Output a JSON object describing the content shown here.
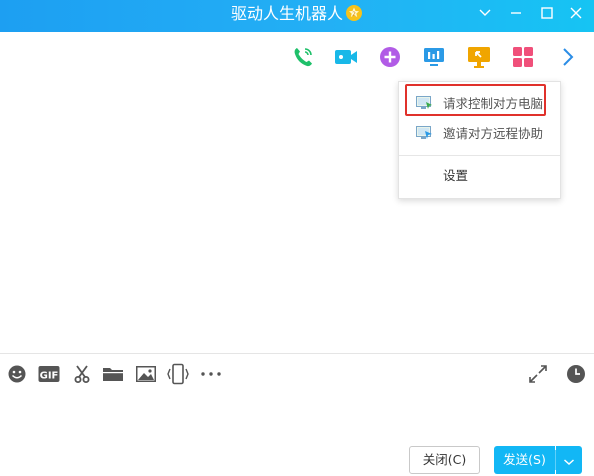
{
  "window": {
    "title": "驱动人生机器人",
    "badge_icon": "star-badge-icon",
    "controls": [
      "chevron-down-icon",
      "minimize-icon",
      "maximize-icon",
      "close-icon"
    ]
  },
  "top_toolbar": {
    "icons": [
      "phone-call-icon",
      "video-call-icon",
      "add-circle-icon",
      "screen-share-icon",
      "remote-assist-icon",
      "apps-grid-icon",
      "chevron-right-icon"
    ],
    "colors": {
      "phone": "#1fc06a",
      "video": "#18b8e8",
      "add": "#b15be6",
      "screen": "#2b9ae6",
      "remote": "#f0a500",
      "apps": "#f0507a",
      "chevron": "#2b8de6"
    }
  },
  "remote_menu": {
    "items": [
      {
        "label": "请求控制对方电脑",
        "icon": "request-control-icon"
      },
      {
        "label": "邀请对方远程协助",
        "icon": "invite-assist-icon"
      },
      {
        "label": "设置"
      }
    ],
    "highlight_color": "#e0312b"
  },
  "bottom_toolbar": {
    "icons": [
      "emoji-icon",
      "gif-icon",
      "screenshot-scissors-icon",
      "folder-icon",
      "image-icon",
      "shake-icon",
      "more-icon",
      "expand-icon",
      "history-clock-icon"
    ],
    "gif_label": "GIF"
  },
  "buttons": {
    "close_label": "关闭(C)",
    "send_label": "发送(S)"
  },
  "colors": {
    "titlebar": "#1d9ff2",
    "send_button": "#12b7f5"
  }
}
